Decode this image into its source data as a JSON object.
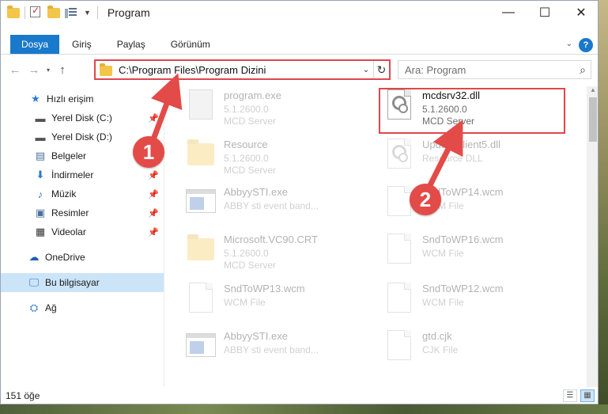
{
  "window": {
    "title": "Program"
  },
  "controls": {
    "minimize": "—",
    "maximize": "☐",
    "close": "✕"
  },
  "tabs": [
    {
      "label": "Dosya"
    },
    {
      "label": "Giriş"
    },
    {
      "label": "Paylaş"
    },
    {
      "label": "Görünüm"
    }
  ],
  "nav": {
    "address": "C:\\Program Files\\Program Dizini",
    "search_placeholder": "Ara: Program"
  },
  "sidebar": {
    "items": [
      {
        "label": "Hızlı erişim",
        "icon": "star-icon"
      },
      {
        "label": "Yerel Disk (C:)",
        "icon": "drive-icon"
      },
      {
        "label": "Yerel Disk (D:)",
        "icon": "drive-icon"
      },
      {
        "label": "Belgeler",
        "icon": "documents-icon"
      },
      {
        "label": "İndirmeler",
        "icon": "download-icon"
      },
      {
        "label": "Müzik",
        "icon": "music-icon"
      },
      {
        "label": "Resimler",
        "icon": "pictures-icon"
      },
      {
        "label": "Videolar",
        "icon": "videos-icon"
      },
      {
        "label": "OneDrive",
        "icon": "cloud-icon"
      },
      {
        "label": "Bu bilgisayar",
        "icon": "computer-icon"
      },
      {
        "label": "Ağ",
        "icon": "network-icon"
      }
    ]
  },
  "files": [
    {
      "name": "program.exe",
      "line2": "5.1.2600.0",
      "line3": "MCD Server"
    },
    {
      "name": "mcdsrv32.dll",
      "line2": "5.1.2600.0",
      "line3": "MCD Server"
    },
    {
      "name": "Resource",
      "line2": "5.1.2600.0",
      "line3": "MCD Server"
    },
    {
      "name": "UpdateClient5.dll",
      "line2": "Resource DLL",
      "line3": ""
    },
    {
      "name": "AbbyySTI.exe",
      "line2": "ABBY sti event band...",
      "line3": ""
    },
    {
      "name": "SndToWP14.wcm",
      "line2": "WCM File",
      "line3": ""
    },
    {
      "name": "Microsoft.VC90.CRT",
      "line2": "5.1.2600.0",
      "line3": "MCD Server"
    },
    {
      "name": "SndToWP16.wcm",
      "line2": "WCM File",
      "line3": ""
    },
    {
      "name": "SndToWP13.wcm",
      "line2": "WCM File",
      "line3": ""
    },
    {
      "name": "SndToWP12.wcm",
      "line2": "WCM File",
      "line3": ""
    },
    {
      "name": "AbbyySTI.exe",
      "line2": "ABBY sti event band...",
      "line3": ""
    },
    {
      "name": "gtd.cjk",
      "line2": "CJK File",
      "line3": ""
    }
  ],
  "status": {
    "count": "151 öğe"
  },
  "callouts": {
    "one": "1",
    "two": "2"
  }
}
